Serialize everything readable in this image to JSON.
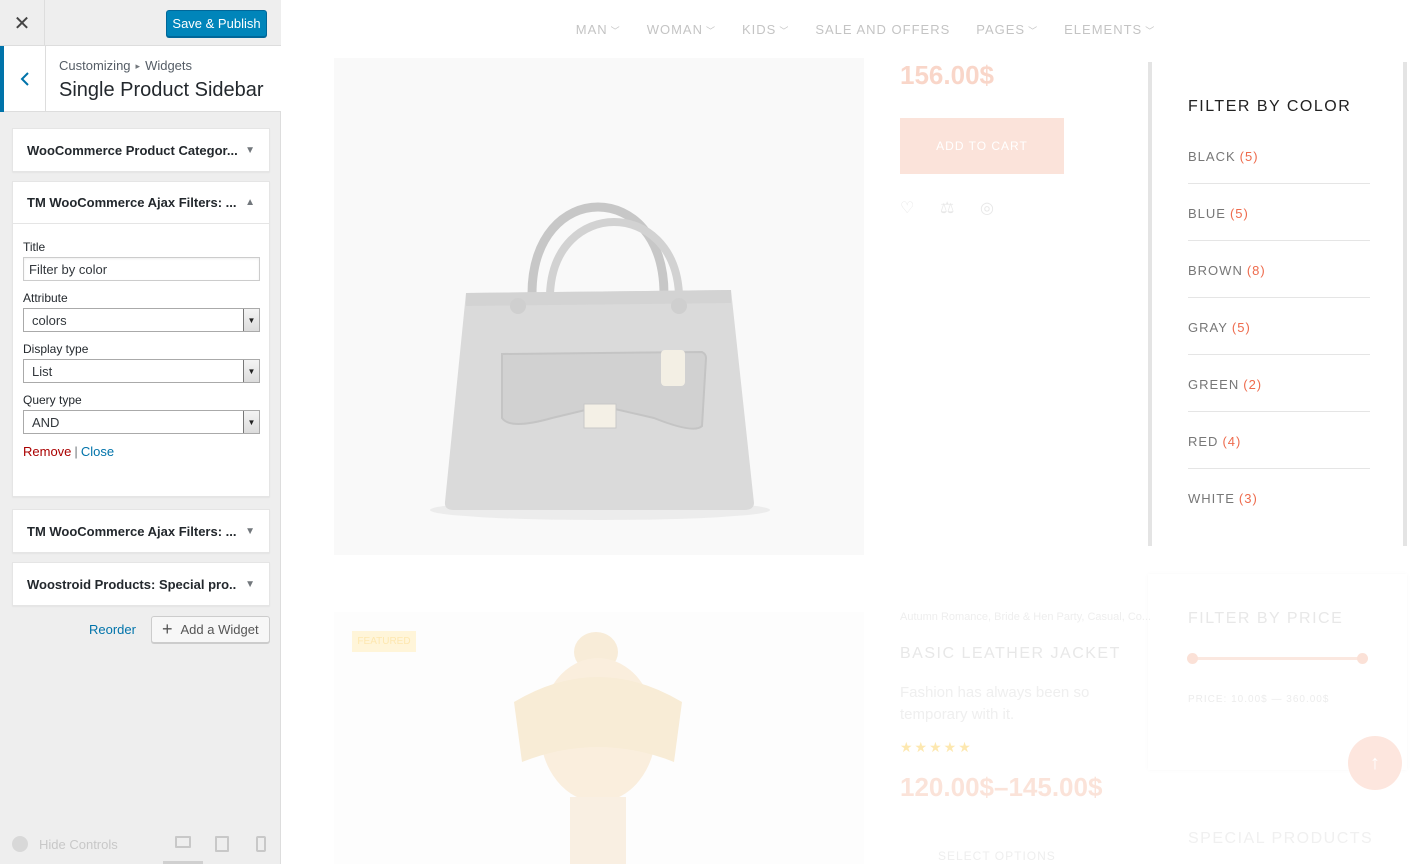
{
  "customizer": {
    "close_glyph": "✕",
    "save_label": "Save & Publish",
    "breadcrumb": {
      "root": "Customizing",
      "section": "Widgets"
    },
    "panel_title": "Single Product Sidebar",
    "widgets": [
      {
        "title": "WooCommerce Product Categor...",
        "expanded": false
      },
      {
        "title": "TM WooCommerce Ajax Filters: ...",
        "expanded": true,
        "fields": {
          "title_label": "Title",
          "title_value": "Filter by color",
          "attribute_label": "Attribute",
          "attribute_value": "colors",
          "display_type_label": "Display type",
          "display_type_value": "List",
          "query_type_label": "Query type",
          "query_type_value": "AND"
        },
        "remove_label": "Remove",
        "close_label": "Close"
      },
      {
        "title": "TM WooCommerce Ajax Filters: ...",
        "expanded": false
      },
      {
        "title": "Woostroid Products:",
        "subtitle": "Special pro...",
        "expanded": false
      }
    ],
    "reorder_label": "Reorder",
    "add_widget_label": "Add a Widget",
    "hide_controls_label": "Hide Controls",
    "accent_color": "#0085ba"
  },
  "preview": {
    "nav": [
      "MAN",
      "WOMAN",
      "KIDS",
      "SALE AND OFFERS",
      "PAGES",
      "ELEMENTS"
    ],
    "product1": {
      "price": "156.00$",
      "add_to_cart": "ADD TO CART"
    },
    "filter_color": {
      "title": "FILTER BY COLOR",
      "items": [
        {
          "name": "BLACK",
          "count": "(5)"
        },
        {
          "name": "BLUE",
          "count": "(5)"
        },
        {
          "name": "BROWN",
          "count": "(8)"
        },
        {
          "name": "GRAY",
          "count": "(5)"
        },
        {
          "name": "GREEN",
          "count": "(2)"
        },
        {
          "name": "RED",
          "count": "(4)"
        },
        {
          "name": "WHITE",
          "count": "(3)"
        }
      ],
      "count_color": "#ee6b4d"
    },
    "filter_price": {
      "title": "FILTER BY PRICE",
      "range": "PRICE: 10.00$ — 360.00$"
    },
    "product2": {
      "badge": "FEATURED",
      "tags": "Autumn Romance, Bride & Hen Party, Casual, Co...",
      "name": "BASIC LEATHER JACKET",
      "description": "Fashion has always been so temporary with it.",
      "stars": "★★★★★",
      "price": "120.00$–145.00$",
      "select_options": "SELECT OPTIONS"
    },
    "special_products": "SPECIAL PRODUCTS"
  }
}
